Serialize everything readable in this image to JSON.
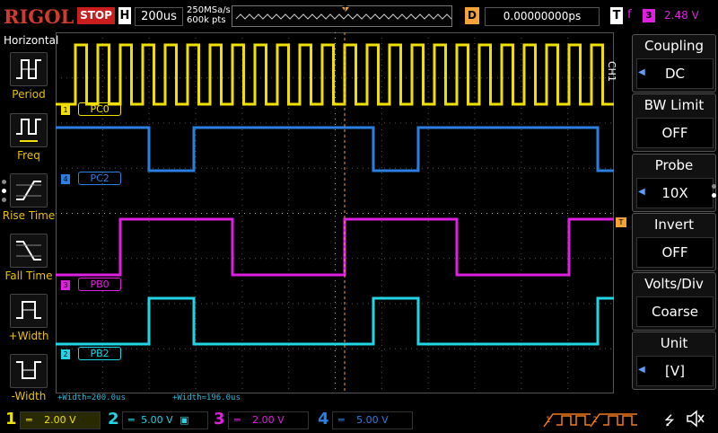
{
  "topbar": {
    "brand": "RIGOL",
    "run_state": "STOP",
    "h_label": "H",
    "h_timebase": "200us",
    "sample_rate": "250MSa/s",
    "memory_depth": "600k pts",
    "trigger_marker": "T",
    "d_label": "D",
    "delay": "0.00000000ps",
    "t_label": "T",
    "trigger_edge": "f",
    "trigger_source": "3",
    "trigger_level": "2.48 V"
  },
  "left_menu": {
    "title": "Horizontal",
    "items": [
      {
        "label": "Period",
        "icon": "period-icon"
      },
      {
        "label": "Freq",
        "icon": "frequency-icon"
      },
      {
        "label": "Rise Time",
        "icon": "rise-time-icon"
      },
      {
        "label": "Fall Time",
        "icon": "fall-time-icon"
      },
      {
        "label": "+Width",
        "icon": "positive-width-icon"
      },
      {
        "label": "-Width",
        "icon": "negative-width-icon"
      }
    ]
  },
  "waveforms": {
    "ch1": {
      "label": "PC0",
      "marker": "1",
      "color": "#f0e000"
    },
    "ch4": {
      "label": "PC2",
      "marker": "4",
      "color": "#2a7fe0"
    },
    "ch3": {
      "label": "PB0",
      "marker": "3",
      "color": "#e020e0"
    },
    "ch2": {
      "label": "PB2",
      "marker": "2",
      "color": "#20d6e6"
    }
  },
  "measurements": {
    "m1": "+Width=200.0us",
    "m2": "+Width=196.0us"
  },
  "right_menu": {
    "channel_tag": "CH1",
    "items": [
      {
        "title": "Coupling",
        "value": "DC",
        "arrow": true
      },
      {
        "title": "BW Limit",
        "value": "OFF",
        "arrow": false
      },
      {
        "title": "Probe",
        "value": "10X",
        "arrow": true
      },
      {
        "title": "Invert",
        "value": "OFF",
        "arrow": false
      },
      {
        "title": "Volts/Div",
        "value": "Coarse",
        "arrow": false
      },
      {
        "title": "Unit",
        "value": "[V]",
        "arrow": true
      }
    ]
  },
  "bottombar": {
    "channels": [
      {
        "num": "1",
        "scale": "2.00 V",
        "color": "#f0e000"
      },
      {
        "num": "2",
        "scale": "5.00 V",
        "color": "#20d6e6"
      },
      {
        "num": "3",
        "scale": "2.00 V",
        "color": "#e020e0"
      },
      {
        "num": "4",
        "scale": "5.00 V",
        "color": "#2a7fe0"
      }
    ],
    "parallel_bus": [
      "1",
      "2"
    ]
  }
}
